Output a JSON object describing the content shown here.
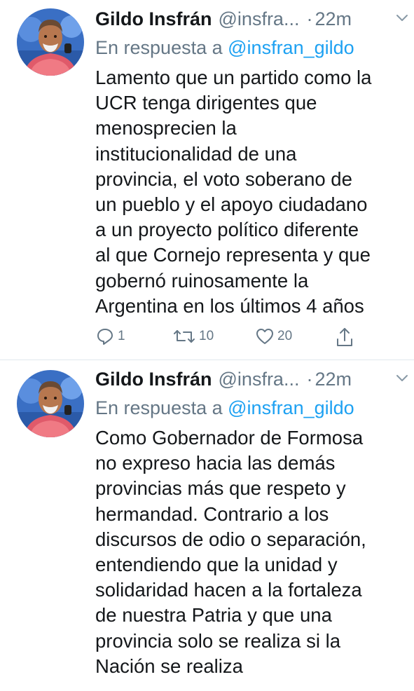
{
  "tweets": [
    {
      "author": {
        "name": "Gildo Insfrán",
        "handle": "@insfra...",
        "time": "22m",
        "separator": "·"
      },
      "reply_prefix": "En respuesta a",
      "reply_mention": "@insfran_gildo",
      "text_lines": [
        "Lamento que un partido como la",
        "UCR tenga dirigentes que",
        "menosprecien la",
        "institucionalidad de una",
        "provincia, el voto soberano de",
        "un pueblo y el apoyo ciudadano",
        "a un proyecto político diferente",
        "al que Cornejo representa y que",
        "gobernó ruinosamente la",
        "Argentina en los últimos 4 años"
      ],
      "actions": {
        "replies": "1",
        "retweets": "10",
        "likes": "20"
      }
    },
    {
      "author": {
        "name": "Gildo Insfrán",
        "handle": "@insfra...",
        "time": "22m",
        "separator": "·"
      },
      "reply_prefix": "En respuesta a",
      "reply_mention": "@insfran_gildo",
      "text_lines": [
        "Como Gobernador de Formosa",
        "no expreso hacia las demás",
        "provincias más que respeto y",
        "hermandad. Contrario a los",
        "discursos de odio o separación,",
        "entendiendo que la unidad y",
        "solidaridad hacen a la fortaleza",
        "de nuestra Patria y que una",
        "provincia solo se realiza si la",
        "Nación se realiza"
      ]
    }
  ],
  "icons": {
    "reply": "reply-icon",
    "retweet": "retweet-icon",
    "like": "heart-icon",
    "share": "share-icon",
    "caret": "chevron-down-icon"
  },
  "colors": {
    "text": "#14171a",
    "secondary": "#657786",
    "link": "#1da1f2",
    "divider": "#e1e8ed",
    "background": "#ffffff"
  }
}
